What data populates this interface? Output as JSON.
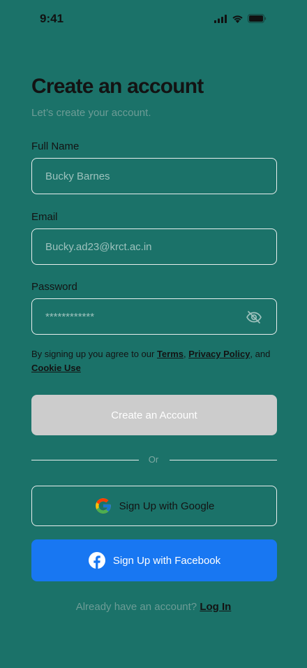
{
  "status_bar": {
    "time": "9:41"
  },
  "header": {
    "title": "Create an account",
    "subtitle": "Let’s create your account."
  },
  "form": {
    "full_name": {
      "label": "Full Name",
      "placeholder": "Bucky Barnes"
    },
    "email": {
      "label": "Email",
      "placeholder": "Bucky.ad23@krct.ac.in"
    },
    "password": {
      "label": "Password",
      "placeholder": "************"
    }
  },
  "terms": {
    "prefix": "By signing up you agree to our ",
    "terms_link": "Terms",
    "comma": ", ",
    "privacy_link": "Privacy Policy",
    "and": ", and ",
    "cookie_link": "Cookie Use"
  },
  "buttons": {
    "create_account": "Create an Account",
    "google": "Sign Up with Google",
    "facebook": "Sign Up with Facebook"
  },
  "divider": {
    "text": "Or"
  },
  "footer": {
    "prompt": "Already have an account? ",
    "login_link": "Log In"
  },
  "colors": {
    "background": "#1b7269",
    "facebook_blue": "#1877f2",
    "disabled_button": "#cccccc"
  },
  "icons": [
    "signal-icon",
    "wifi-icon",
    "battery-icon",
    "eye-off-icon",
    "google-logo-icon",
    "facebook-logo-icon"
  ]
}
